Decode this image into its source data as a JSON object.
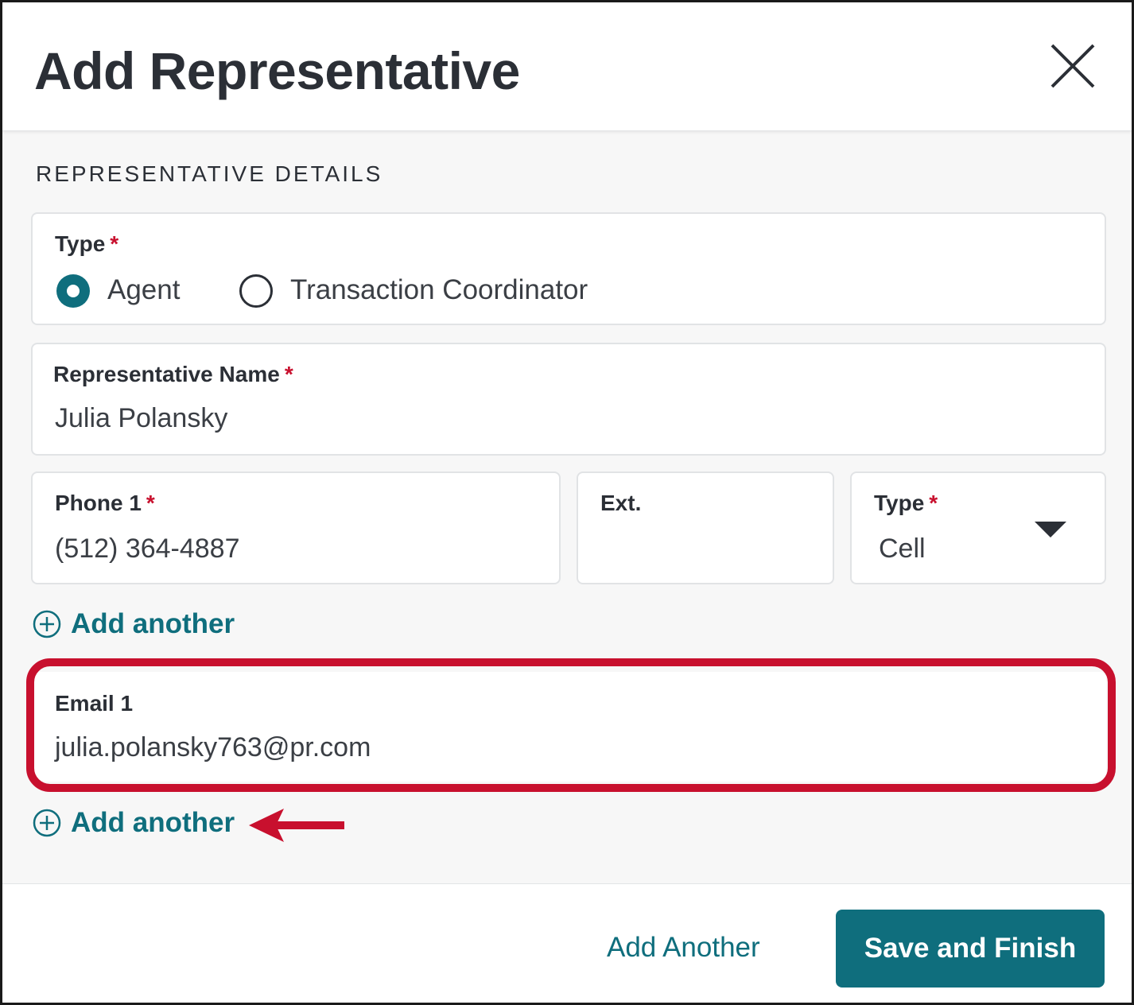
{
  "header": {
    "title": "Add Representative",
    "close_icon": "close-icon"
  },
  "section": {
    "title": "REPRESENTATIVE DETAILS"
  },
  "type_field": {
    "label": "Type",
    "required_marker": "*",
    "options": [
      {
        "label": "Agent",
        "selected": true
      },
      {
        "label": "Transaction Coordinator",
        "selected": false
      }
    ]
  },
  "name_field": {
    "label": "Representative Name",
    "required_marker": "*",
    "value": "Julia Polansky"
  },
  "phone_field": {
    "label": "Phone 1",
    "required_marker": "*",
    "value": "(512) 364-4887"
  },
  "ext_field": {
    "label": "Ext.",
    "value": ""
  },
  "phone_type_field": {
    "label": "Type",
    "required_marker": "*",
    "value": "Cell"
  },
  "phone_add_another": {
    "label": "Add another",
    "icon": "plus-circle-icon"
  },
  "email_field": {
    "label": "Email 1",
    "value": "julia.polansky763@pr.com"
  },
  "email_add_another": {
    "label": "Add another",
    "icon": "plus-circle-icon"
  },
  "annotation": {
    "highlight_color": "#c8102e",
    "arrow_color": "#c8102e"
  },
  "footer": {
    "secondary_label": "Add Another",
    "primary_label": "Save and Finish"
  },
  "colors": {
    "accent": "#0f6e7d",
    "required": "#c8102e",
    "background": "#f7f7f7",
    "text": "#2b2f36"
  }
}
